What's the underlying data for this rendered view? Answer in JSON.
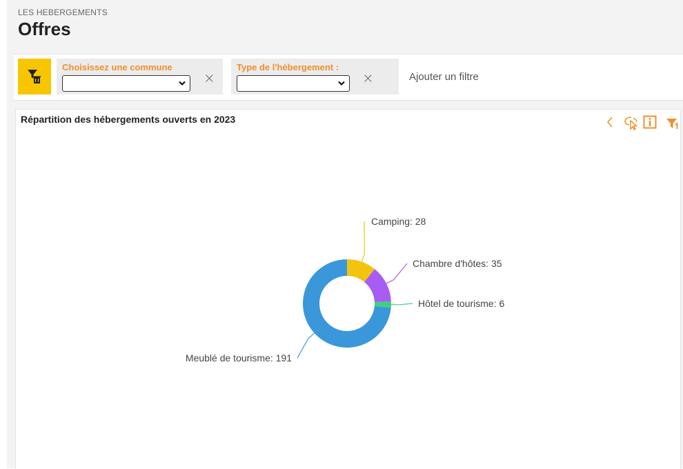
{
  "header": {
    "section_label": "LES HEBERGEMENTS",
    "title": "Offres"
  },
  "filters": {
    "commune_label": "Choisissez une commune",
    "commune_value": "",
    "type_label": "Type de l'hébergement :",
    "type_value": "",
    "close_symbol": "×",
    "add_filter_label": "Ajouter un filtre"
  },
  "icons": {
    "filter_delete": "filter-delete-icon",
    "back": "chevron-left-icon",
    "select_mode": "pointer-select-icon",
    "info": "info-icon",
    "filter": "filter-icon"
  },
  "colors": {
    "accent": "#f0902a",
    "filter_button": "#f7c600"
  },
  "chart_data": {
    "type": "pie",
    "donut": true,
    "title": "Répartition des hébergements ouverts en 2023",
    "slices": [
      {
        "label": "Camping",
        "value": 28,
        "color": "#f2c40f"
      },
      {
        "label": "Chambre d'hôtes",
        "value": 35,
        "color": "#a85cf3"
      },
      {
        "label": "Hôtel de tourisme",
        "value": 6,
        "color": "#3fcf80"
      },
      {
        "label": "Meublé de tourisme",
        "value": 191,
        "color": "#3a97da"
      }
    ]
  }
}
